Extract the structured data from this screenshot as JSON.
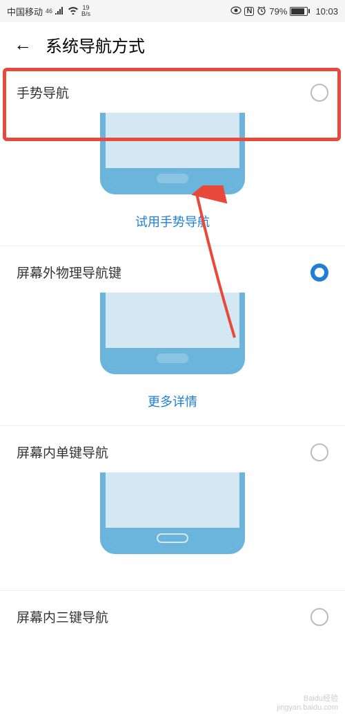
{
  "status": {
    "carrier": "中国移动",
    "net_badge": "46",
    "speed_val": "19",
    "speed_unit": "B/s",
    "nfc": "N",
    "battery_pct": "79%",
    "time": "10:03"
  },
  "header": {
    "title": "系统导航方式"
  },
  "options": [
    {
      "label": "手势导航",
      "selected": false,
      "action": "试用手势导航"
    },
    {
      "label": "屏幕外物理导航键",
      "selected": true,
      "action": "更多详情"
    },
    {
      "label": "屏幕内单键导航",
      "selected": false,
      "action": ""
    },
    {
      "label": "屏幕内三键导航",
      "selected": false,
      "action": ""
    }
  ],
  "watermark": {
    "line1": "Baidu经验",
    "line2": "jingyan.baidu.com"
  }
}
